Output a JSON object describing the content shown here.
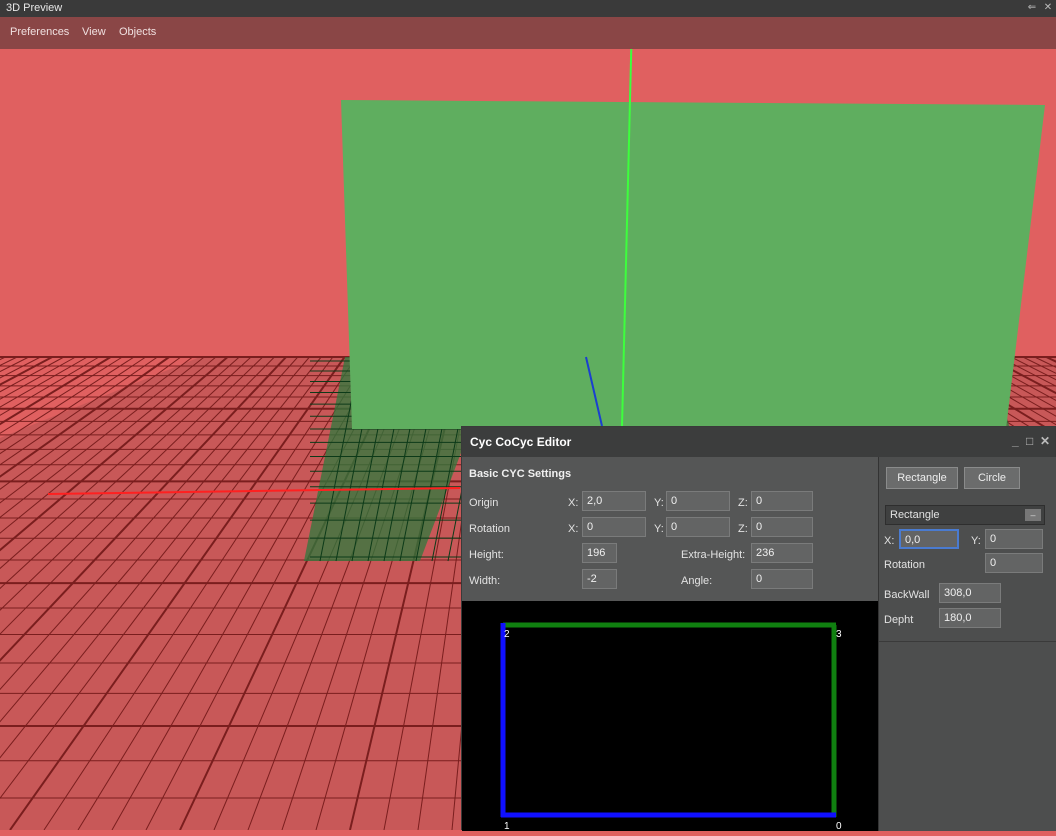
{
  "window": {
    "title": "3D Preview"
  },
  "menu": {
    "items": [
      "Preferences",
      "View",
      "Objects"
    ]
  },
  "editor": {
    "title": "Cyc CoCyc Editor",
    "section_title": "Basic CYC Settings",
    "origin": {
      "label": "Origin",
      "x_label": "X:",
      "x": "2,0",
      "y_label": "Y:",
      "y": "0",
      "z_label": "Z:",
      "z": "0"
    },
    "rotation": {
      "label": "Rotation",
      "x_label": "X:",
      "x": "0",
      "y_label": "Y:",
      "y": "0",
      "z_label": "Z:",
      "z": "0"
    },
    "height": {
      "label": "Height:",
      "value": "196"
    },
    "extra_height": {
      "label": "Extra-Height:",
      "value": "236"
    },
    "width": {
      "label": "Width:",
      "value": "-2"
    },
    "angle": {
      "label": "Angle:",
      "value": "0"
    },
    "corners": [
      "2",
      "3",
      "1",
      "0"
    ]
  },
  "side_panel": {
    "rectangle_button": "Rectangle",
    "circle_button": "Circle",
    "shape_select": "Rectangle",
    "x_label": "X:",
    "x_value": "0,0",
    "y_label": "Y:",
    "y_value": "0",
    "rotation_label": "Rotation",
    "rotation_value": "0",
    "backwall_label": "BackWall",
    "backwall_value": "308,0",
    "depth_label": "Depht",
    "depth_value": "180,0"
  },
  "colors": {
    "background_red": "#e06060",
    "green_wall": "#5fae5f",
    "blue_line": "#1010ff",
    "green_line": "#108010"
  }
}
